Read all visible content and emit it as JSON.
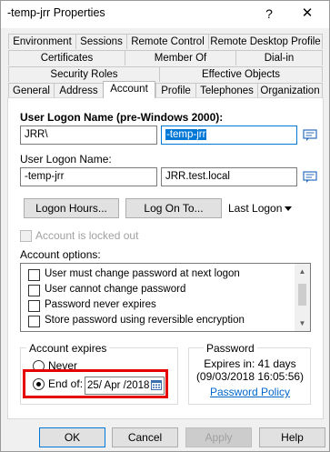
{
  "window": {
    "title": "-temp-jrr Properties",
    "help_glyph": "?",
    "close_glyph": "✕"
  },
  "tabs": {
    "row1": [
      "Environment",
      "Sessions",
      "Remote Control",
      "Remote Desktop Profile"
    ],
    "row2": [
      "Certificates",
      "Member Of",
      "Dial-in"
    ],
    "row3": [
      "Security Roles",
      "Effective Objects"
    ],
    "row4": [
      "General",
      "Address",
      "Account",
      "Profile",
      "Telephones",
      "Organization"
    ],
    "active": "Account"
  },
  "account": {
    "pre2000_label": "User Logon Name (pre-Windows 2000):",
    "pre2000_domain": "JRR\\",
    "pre2000_name": "-temp-jrr",
    "logon_label": "User Logon Name:",
    "logon_name": "-temp-jrr",
    "logon_suffix": "JRR.test.local",
    "logon_hours_button": "Logon Hours...",
    "logon_on_to_button": "Log On To...",
    "last_logon_label": "Last Logon",
    "locked_out_label": "Account is locked out",
    "options_label": "Account options:",
    "options": [
      {
        "label": "User must change password at next logon",
        "checked": false
      },
      {
        "label": "User cannot change password",
        "checked": false
      },
      {
        "label": "Password never expires",
        "checked": false
      },
      {
        "label": "Store password using reversible encryption",
        "checked": false
      }
    ]
  },
  "expires": {
    "group_title": "Account expires",
    "never_label": "Never",
    "end_of_label": "End of:",
    "selected": "end_of",
    "date_value": "25/ Apr /2018"
  },
  "password": {
    "group_title": "Password",
    "expires_in": "Expires in: 41 days",
    "expires_at": "(09/03/2018 16:05:56)",
    "policy_link": "Password Policy"
  },
  "footer": {
    "ok": "OK",
    "cancel": "Cancel",
    "apply": "Apply",
    "help": "Help"
  },
  "colors": {
    "accent": "#0078d7",
    "highlight_box": "#e60000"
  }
}
